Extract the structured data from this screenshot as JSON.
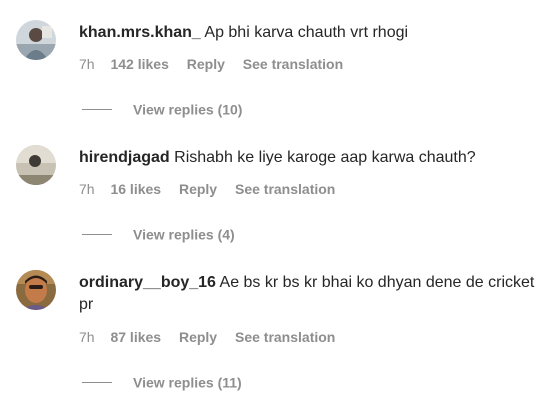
{
  "comments": [
    {
      "username": "khan.mrs.khan_",
      "text": "Ap bhi karva chauth vrt rhogi",
      "time": "7h",
      "likes": "142 likes",
      "reply": "Reply",
      "translate": "See translation",
      "view_replies": "View replies (10)"
    },
    {
      "username": "hirendjagad",
      "text": "Rishabh ke liye karoge aap karwa chauth?",
      "time": "7h",
      "likes": "16 likes",
      "reply": "Reply",
      "translate": "See translation",
      "view_replies": "View replies (4)"
    },
    {
      "username": "ordinary__boy_16",
      "text": "Ae bs kr bs kr bhai ko dhyan dene de cricket pr",
      "time": "7h",
      "likes": "87 likes",
      "reply": "Reply",
      "translate": "See translation",
      "view_replies": "View replies (11)"
    }
  ]
}
